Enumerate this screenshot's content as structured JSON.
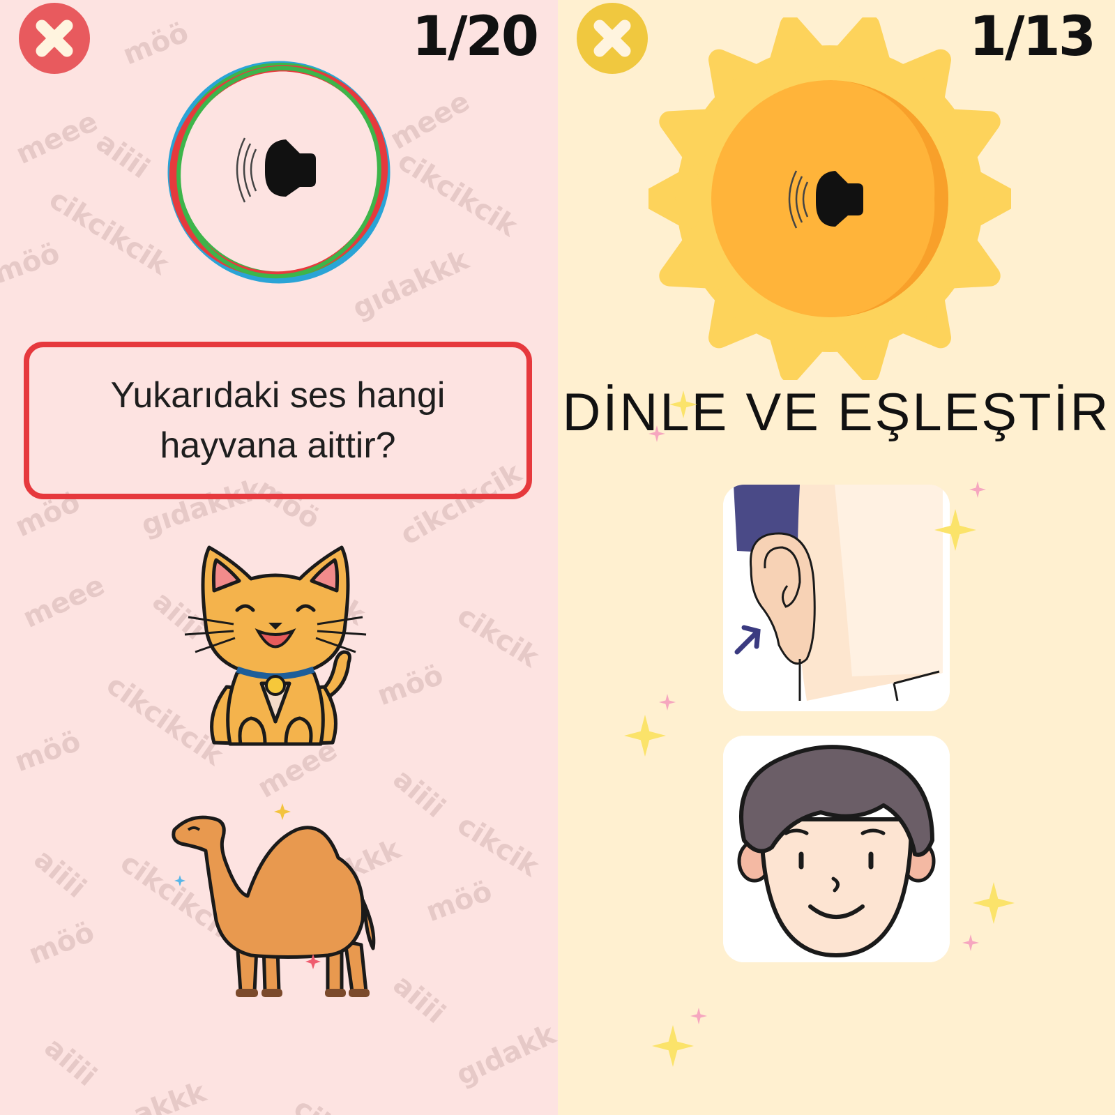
{
  "left_panel": {
    "counter": "1/20",
    "question": "Yukarıdaki ses hangi hayvana aittir?",
    "watermarks": [
      "möö",
      "meee",
      "aiiii",
      "cikcikcik",
      "möö",
      "gıdakkk",
      "meee",
      "cikcikcik",
      "möö",
      "gıdakkk",
      "möö",
      "cikcikcik",
      "meee",
      "aiiii",
      "kk",
      "cikcik",
      "möö",
      "möö",
      "cikcikcik",
      "meee",
      "aiiii",
      "cikcik",
      "akkk",
      "aiiii",
      "cikcikcik",
      "möö",
      "möö",
      "aiiii",
      "gıdakk",
      "aiiii",
      "akkk",
      "cik"
    ],
    "answers": [
      "cat",
      "camel"
    ]
  },
  "right_panel": {
    "counter": "1/13",
    "title": "DİNLE VE EŞLEŞTİR",
    "cards": [
      "ear",
      "face"
    ]
  },
  "colors": {
    "left_bg": "#fde3e1",
    "right_bg": "#fff0d0",
    "left_close": "#e85a5e",
    "right_close": "#f0c83f",
    "question_border": "#e6393d",
    "sun": "#ffb43a"
  },
  "icons": [
    "close-icon",
    "speaker-icon",
    "cat-image",
    "camel-image",
    "sun-image",
    "ear-image",
    "face-image",
    "sparkle-icon"
  ]
}
